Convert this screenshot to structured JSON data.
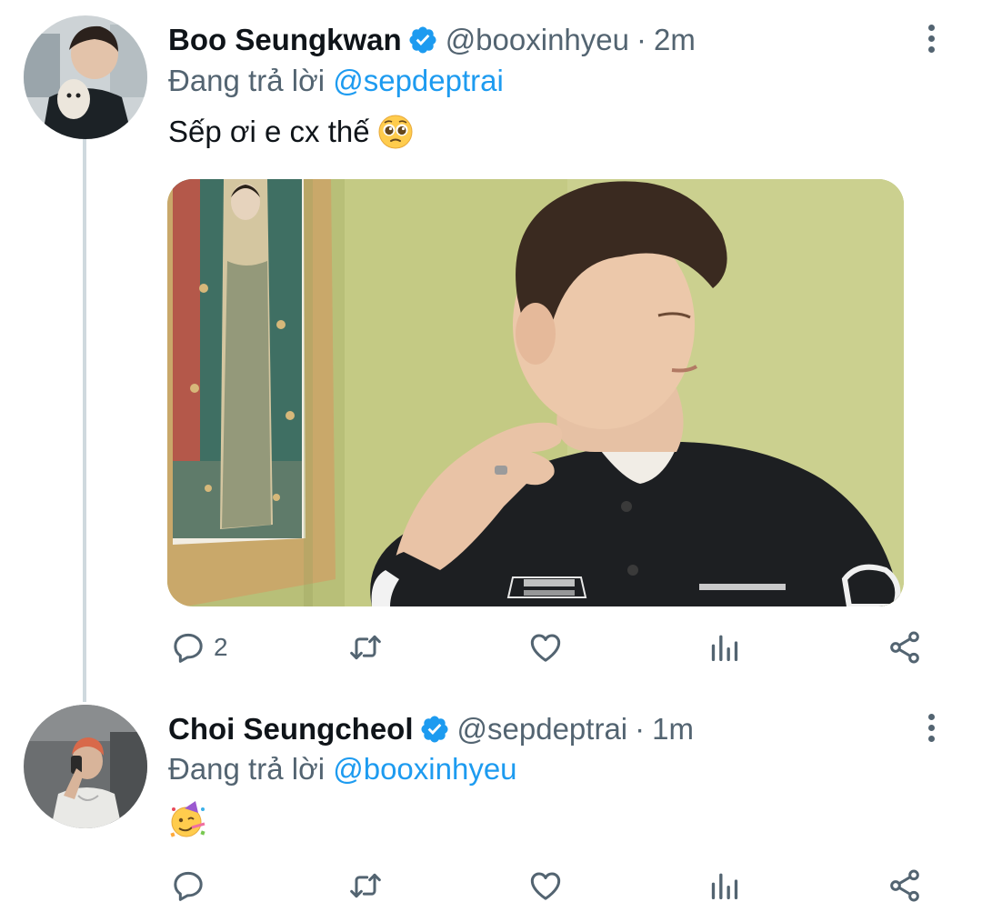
{
  "tweets": [
    {
      "display_name": "Boo Seungkwan",
      "handle": "@booxinhyeu",
      "separator": "·",
      "time": "2m",
      "reply_prefix": "Đang trả lời",
      "reply_mention": "@sepdeptrai",
      "text": "Sếp ơi e cx thế",
      "emoji": "pleading-face",
      "has_media": true,
      "reply_count": "2"
    },
    {
      "display_name": "Choi Seungcheol",
      "handle": "@sepdeptrai",
      "separator": "·",
      "time": "1m",
      "reply_prefix": "Đang trả lời",
      "reply_mention": "@booxinhyeu",
      "text": "",
      "emoji": "partying-face",
      "has_media": false,
      "reply_count": ""
    }
  ],
  "colors": {
    "accent": "#1d9bf0",
    "secondary_text": "#536471",
    "thread_line": "#cfd9de"
  },
  "icons": [
    "verified-badge-icon",
    "more-options-icon",
    "reply-icon",
    "retweet-icon",
    "like-icon",
    "analytics-icon",
    "share-icon"
  ]
}
